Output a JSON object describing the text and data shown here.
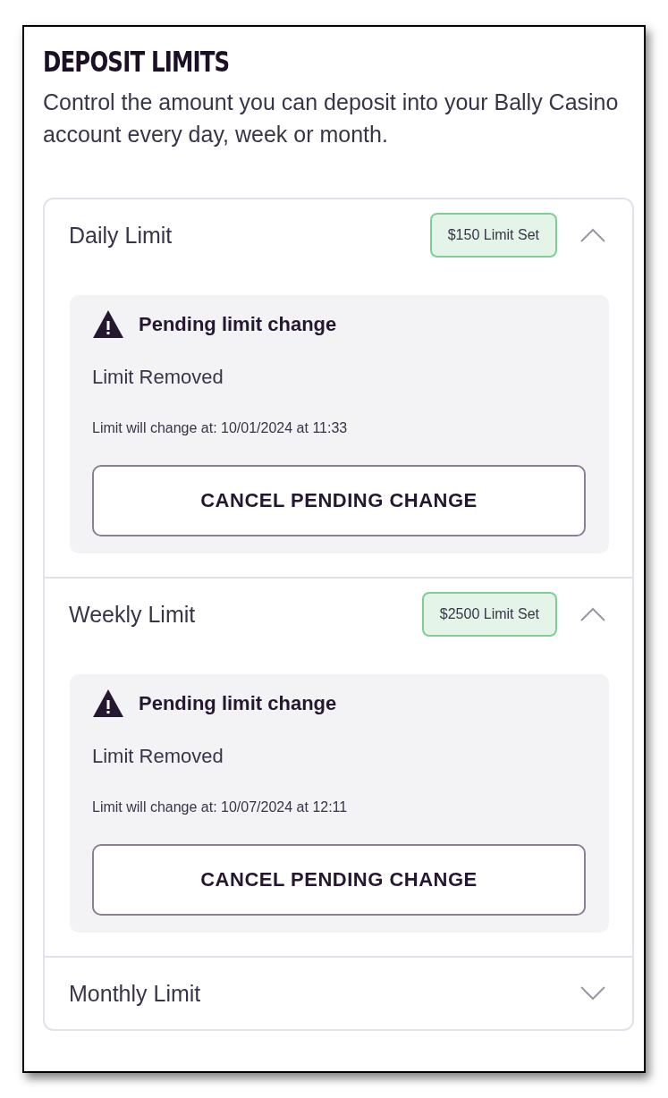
{
  "title": "DEPOSIT LIMITS",
  "description": "Control the amount you can deposit into your Bally Casino account every day, week or month.",
  "limits": [
    {
      "label": "Daily Limit",
      "badge": "$150 Limit Set",
      "expanded": true,
      "pending": {
        "title": "Pending limit change",
        "status": "Limit Removed",
        "change_time": "Limit will change at: 10/01/2024 at 11:33",
        "button": "CANCEL PENDING CHANGE"
      }
    },
    {
      "label": "Weekly Limit",
      "badge": "$2500 Limit Set",
      "expanded": true,
      "pending": {
        "title": "Pending limit change",
        "status": "Limit Removed",
        "change_time": "Limit will change at: 10/07/2024 at 12:11",
        "button": "CANCEL PENDING CHANGE"
      }
    },
    {
      "label": "Monthly Limit",
      "expanded": false
    }
  ]
}
